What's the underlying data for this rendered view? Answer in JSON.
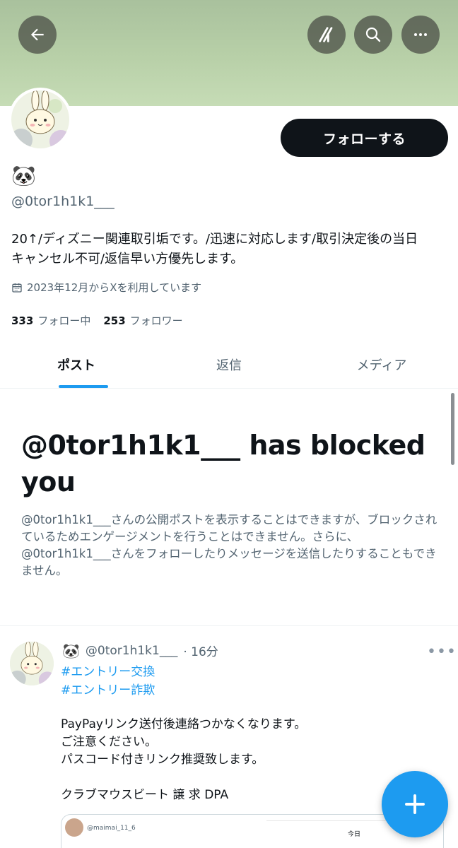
{
  "header": {
    "back_icon": "arrow-left-icon",
    "grok_icon": "grok-icon",
    "search_icon": "search-icon",
    "more_icon": "more-horizontal-icon"
  },
  "profile": {
    "display_name": "🐼",
    "handle": "@0tor1h1k1___",
    "follow_label": "フォローする",
    "bio_line1": "20↑/ディズニー関連取引垢です。/迅速に対応します/取引決定後の当日",
    "bio_line2": "キャンセル不可/返信早い方優先します。",
    "joined": "2023年12月からXを利用しています",
    "following_count": "333",
    "following_label": "フォロー中",
    "followers_count": "253",
    "followers_label": "フォロワー"
  },
  "tabs": [
    {
      "label": "ポスト",
      "active": true
    },
    {
      "label": "返信",
      "active": false
    },
    {
      "label": "メディア",
      "active": false
    }
  ],
  "blocked": {
    "title": "@0tor1h1k1___ has blocked you",
    "description": "@0tor1h1k1___さんの公開ポストを表示することはできますが、ブロックされているためエンゲージメントを行うことはできません。さらに、@0tor1h1k1___さんをフォローしたりメッセージを送信したりすることもできません。"
  },
  "post": {
    "author_emoji": "🐼",
    "author_handle": "@0tor1h1k1___",
    "time": "· 16分",
    "more": "•••",
    "hashtags": [
      "#エントリー交換",
      "#エントリー詐欺"
    ],
    "lines": [
      "PayPayリンク送付後連絡つかなくなります。",
      "ご注意ください。",
      "パスコード付きリンク推奨致します。",
      "",
      "クラブマウスビート 譲 求 DPA"
    ],
    "media": {
      "handle": "@maimai_11_6",
      "today": "今日"
    }
  },
  "fab": {
    "icon": "plus-icon"
  },
  "colors": {
    "accent": "#1d9bf0",
    "text": "#0f1419",
    "secondary": "#536471",
    "banner": "#b8d0a8"
  }
}
